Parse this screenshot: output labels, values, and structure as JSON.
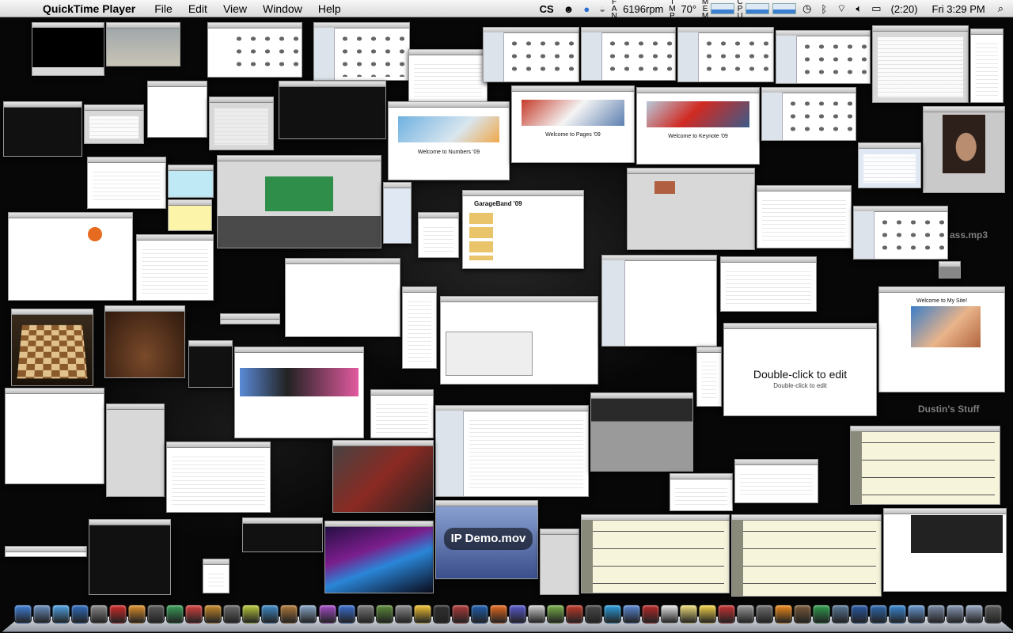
{
  "menubar": {
    "app_name": "QuickTime Player",
    "menus": [
      "File",
      "Edit",
      "View",
      "Window",
      "Help"
    ],
    "status": {
      "fan_label": "FAN",
      "fan_speed": "6196rpm",
      "temp_label": "TMP",
      "temperature": "70°",
      "mem_label": "MEM",
      "cpu_label": "CPU",
      "battery": "(2:20)",
      "clock": "Fri 3:29 PM"
    }
  },
  "windows": {
    "numbers_title": "Welcome to Numbers '09",
    "pages_title": "Welcome to Pages '09",
    "keynote_title": "Welcome to Keynote '09",
    "garageband_title": "GarageBand '09",
    "movie_title": "IP Demo.mov",
    "keynote_placeholder": "Double-click to edit",
    "keynote_sub": "Double-click to edit",
    "mysite_title": "Welcome to My Site!"
  },
  "desktop_items": {
    "mp3_label": "ass.mp3",
    "folder_label": "Dustin's Stuff"
  },
  "dock": {
    "icons": [
      "finder-icon",
      "preview-icon",
      "ichat-icon",
      "safari-icon",
      "system-preferences-icon",
      "opera-icon",
      "keynote-icon",
      "script-editor-icon",
      "chart-icon",
      "ical-icon",
      "garageband-icon",
      "gimp-icon",
      "lemonade-icon",
      "photo-icon",
      "stamp-icon",
      "spotlight-icon",
      "pinwheel-icon",
      "itunes-icon",
      "timemachine-icon",
      "rocket-icon",
      "calculator-icon",
      "duck-icon",
      "terminal-icon",
      "dictionary-icon",
      "flash-icon",
      "firefox-icon",
      "pen-icon",
      "textedit-icon",
      "fruit-icon",
      "photobooth-icon",
      "slideshow-icon",
      "skype-icon",
      "iphoto-icon",
      "pdf-icon",
      "pages-icon",
      "notes-icon",
      "stickies-icon",
      "cs-icon",
      "printer-icon",
      "automator-icon",
      "vlc-icon",
      "camera-icon",
      "numbers-icon",
      "quill-icon",
      "clock-icon",
      "globe-icon",
      "quicktime-icon",
      "folder-icon",
      "applications-icon",
      "documents-icon",
      "downloads-icon",
      "trash-icon"
    ]
  },
  "colors": {
    "menubar": "#e8e8e8",
    "desktop": "#070707",
    "window_chrome": "#bdbdbd"
  }
}
